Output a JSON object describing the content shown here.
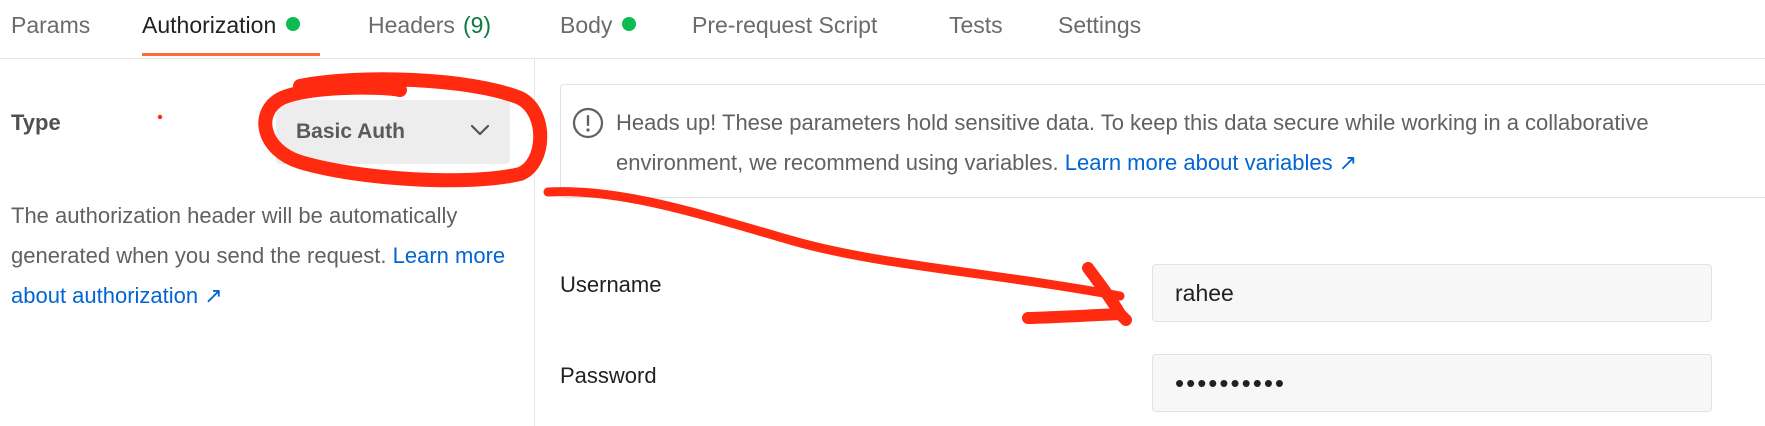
{
  "tabs": {
    "params": "Params",
    "authorization": "Authorization",
    "headers": "Headers",
    "headers_count": "(9)",
    "body": "Body",
    "prerequest": "Pre-request Script",
    "tests": "Tests",
    "settings": "Settings"
  },
  "auth": {
    "type_label": "Type",
    "type_value": "Basic Auth",
    "help_text": "The authorization header will be automatically generated when you send the request.",
    "help_link": "Learn more about authorization ↗"
  },
  "banner": {
    "line1": "Heads up! These parameters hold sensitive data. To keep this data secure while working in a collaborative",
    "line2": "environment, we recommend using variables.",
    "link": "Learn more about variables ↗"
  },
  "fields": {
    "username_label": "Username",
    "username_value": "rahee",
    "password_label": "Password",
    "password_value": "••••••••••"
  },
  "colors": {
    "accent": "#ff6c37",
    "status_dot": "#0cbb52",
    "link": "#0265d2",
    "annotation": "#ff2a0f"
  }
}
